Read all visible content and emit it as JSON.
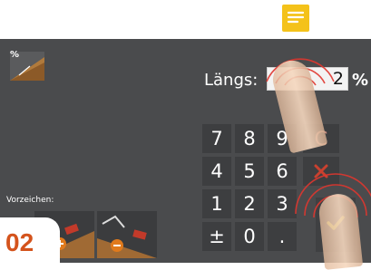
{
  "step_badge": "02",
  "field": {
    "label": "Längs:",
    "value": "2",
    "unit": "%"
  },
  "slope_icon": {
    "text": "%",
    "icon": "slope-percent-icon"
  },
  "keypad": {
    "row1": [
      "7",
      "8",
      "9",
      "C"
    ],
    "row2": [
      "4",
      "5",
      "6"
    ],
    "row3": [
      "1",
      "2",
      "3"
    ],
    "row4": [
      "±",
      "0",
      "."
    ]
  },
  "actions": {
    "cancel_icon": "cancel-x-icon",
    "ok_icon": "confirm-check-icon"
  },
  "sign": {
    "label": "Vorzeichen:",
    "buttons": [
      "sign-plus-icon",
      "sign-minus-icon"
    ]
  },
  "overlay": {
    "note_icon": "note-icon"
  },
  "colors": {
    "screen": "#4a4b4d",
    "key": "#3d3e40",
    "accent": "#d4531c",
    "note": "#f4c21a",
    "ripple": "#e0362f"
  }
}
